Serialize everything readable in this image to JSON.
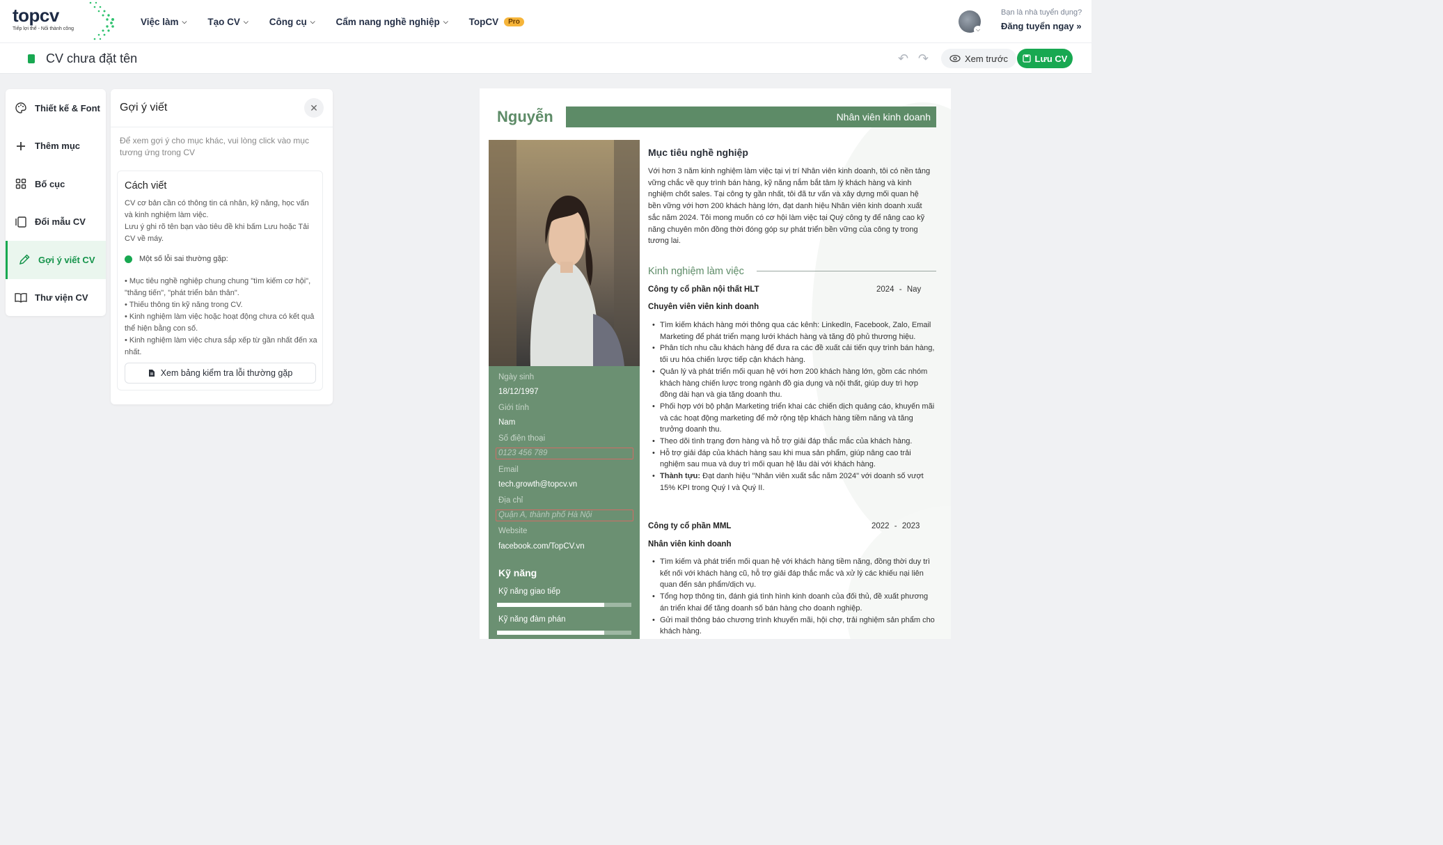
{
  "header": {
    "logo_text_top": "top",
    "logo_text_cv": "cv",
    "logo_tagline": "Tiếp lợi thế - Nối thành công",
    "nav": [
      {
        "label": "Việc làm"
      },
      {
        "label": "Tạo CV"
      },
      {
        "label": "Công cụ"
      },
      {
        "label": "Cẩm nang nghề nghiệp"
      }
    ],
    "topcv_label": "TopCV",
    "pro_badge": "Pro",
    "employer_question": "Bạn là nhà tuyển dụng?",
    "employer_cta": "Đăng tuyển ngay"
  },
  "toolbar": {
    "cv_title": "CV chưa đặt tên",
    "preview_label": "Xem trước",
    "save_label": "Lưu CV"
  },
  "sidebar": {
    "items": [
      {
        "label": "Thiết kế & Font"
      },
      {
        "label": "Thêm mục"
      },
      {
        "label": "Bố cục"
      },
      {
        "label": "Đổi mẫu CV"
      },
      {
        "label": "Gợi ý viết CV"
      },
      {
        "label": "Thư viện CV"
      }
    ],
    "active_index": 4
  },
  "panel": {
    "title": "Gợi ý viết",
    "hint": "Để xem gợi ý cho mục khác, vui lòng click vào mục tương ứng trong CV",
    "card_title": "Cách viết",
    "card_body_1": "CV cơ bản cần có thông tin cá nhân, kỹ năng, học vấn và kinh nghiệm làm việc.",
    "card_body_2": "Lưu ý ghi rõ tên bạn vào tiêu đề khi bấm Lưu hoặc Tải CV về máy.",
    "mistakes_label": "Một số lỗi sai thường gặp:",
    "mistakes": [
      "• Mục tiêu nghề nghiệp chung chung \"tìm kiếm cơ hội\", \"thăng tiến\", \"phát triển bản thân\".",
      "• Thiếu thông tin kỹ năng trong CV.",
      "• Kinh nghiệm làm việc hoặc hoạt động chưa có kết quả thể hiện bằng con số.",
      "• Kinh nghiệm làm việc chưa sắp xếp từ gần nhất đến xa nhất."
    ],
    "checklist_button": "Xem bảng kiểm tra lỗi thường gặp"
  },
  "cv": {
    "name": "Nguyễn",
    "position": "Nhân viên kinh doanh",
    "birth_label": "Ngày sinh",
    "birth_value": "18/12/1997",
    "gender_label": "Giới tính",
    "gender_value": "Nam",
    "phone_label": "Số điện thoại",
    "phone_placeholder": "0123 456 789",
    "email_label": "Email",
    "email_value": "tech.growth@topcv.vn",
    "address_label": "Địa chỉ",
    "address_placeholder": "Quận A, thành phố Hà Nội",
    "website_label": "Website",
    "website_value": "facebook.com/TopCV.vn",
    "skills_title": "Kỹ năng",
    "skills": [
      {
        "name": "Kỹ năng giao tiếp",
        "level": 0.8
      },
      {
        "name": "Kỹ năng đàm phán",
        "level": 0.8
      }
    ],
    "objective_title": "Mục tiêu nghề nghiệp",
    "objective_text": "Với hơn 3 năm kinh nghiệm làm việc tại vị trí Nhân viên kinh doanh, tôi có nền tảng vững chắc về quy trình bán hàng, kỹ năng nắm bắt tâm lý khách hàng và kinh nghiệm chốt sales. Tại công ty gần nhất, tôi đã tư vấn và xây dựng mối quan hệ bền vững với hơn 200 khách hàng lớn, đạt danh hiệu Nhân viên kinh doanh xuất sắc năm 2024. Tôi mong muốn có cơ hội làm việc tại Quý công ty để nâng cao kỹ năng chuyên môn đồng thời đóng góp sự phát triển bền vững của công ty trong tương lai.",
    "experience_title": "Kinh nghiệm làm việc",
    "jobs": [
      {
        "company": "Công ty cổ phần nội thất HLT",
        "start": "2024",
        "sep": "-",
        "end": "Nay",
        "role": "Chuyên viên viên kinh doanh",
        "bullets": [
          "Tìm kiếm khách hàng mới thông qua các kênh: LinkedIn, Facebook, Zalo, Email Marketing để phát triển mạng lưới khách hàng và tăng độ phủ thương hiệu.",
          "Phân tích nhu cầu khách hàng để đưa ra các đề xuất cải tiến quy trình bán hàng, tối ưu hóa chiến lược tiếp cận khách hàng.",
          "Quản lý và phát triển mối quan hệ với hơn 200 khách hàng lớn, gồm các nhóm khách hàng chiến lược trong ngành đồ gia dụng và nội thất, giúp duy trì hợp đồng dài hạn và gia tăng doanh thu.",
          "Phối hợp với bộ phận Marketing triển khai các chiến dịch quảng cáo, khuyến mãi và các hoạt động marketing để mở rộng tệp khách hàng tiềm năng và tăng trưởng doanh thu.",
          "Theo dõi tình trạng đơn hàng và hỗ trợ giải đáp thắc mắc của khách hàng.",
          "Hỗ trợ giải đáp của khách hàng sau khi mua sản phẩm, giúp nâng cao trải nghiệm sau mua và duy trì mối quan hệ lâu dài với khách hàng."
        ],
        "achievement_label": "Thành tựu:",
        "achievement_text": " Đạt danh hiệu \"Nhân viên xuất sắc năm 2024\" với doanh số vượt 15% KPI trong Quý I và Quý II."
      },
      {
        "company": "Công ty cổ phần MML",
        "start": "2022",
        "sep": "-",
        "end": "2023",
        "role": "Nhân viên kinh doanh",
        "bullets": [
          "Tìm kiếm và phát triển mối quan hệ với khách hàng tiềm năng, đồng thời duy trì kết nối với khách hàng cũ, hỗ trợ giải đáp thắc mắc và xử lý các khiếu nại liên quan đến sản phẩm/dịch vụ.",
          "Tổng hợp thông tin, đánh giá tình hình kinh doanh của đối thủ, đề xuất phương án triển khai để tăng doanh số bán hàng cho doanh nghiệp.",
          "Gửi mail thông báo chương trình khuyến mãi, hội chợ, trải nghiệm sản phẩm cho khách hàng."
        ]
      }
    ]
  },
  "colors": {
    "brand_green": "#18a851",
    "cv_green": "#5d8b67",
    "cv_sidebar": "#6b9072"
  }
}
